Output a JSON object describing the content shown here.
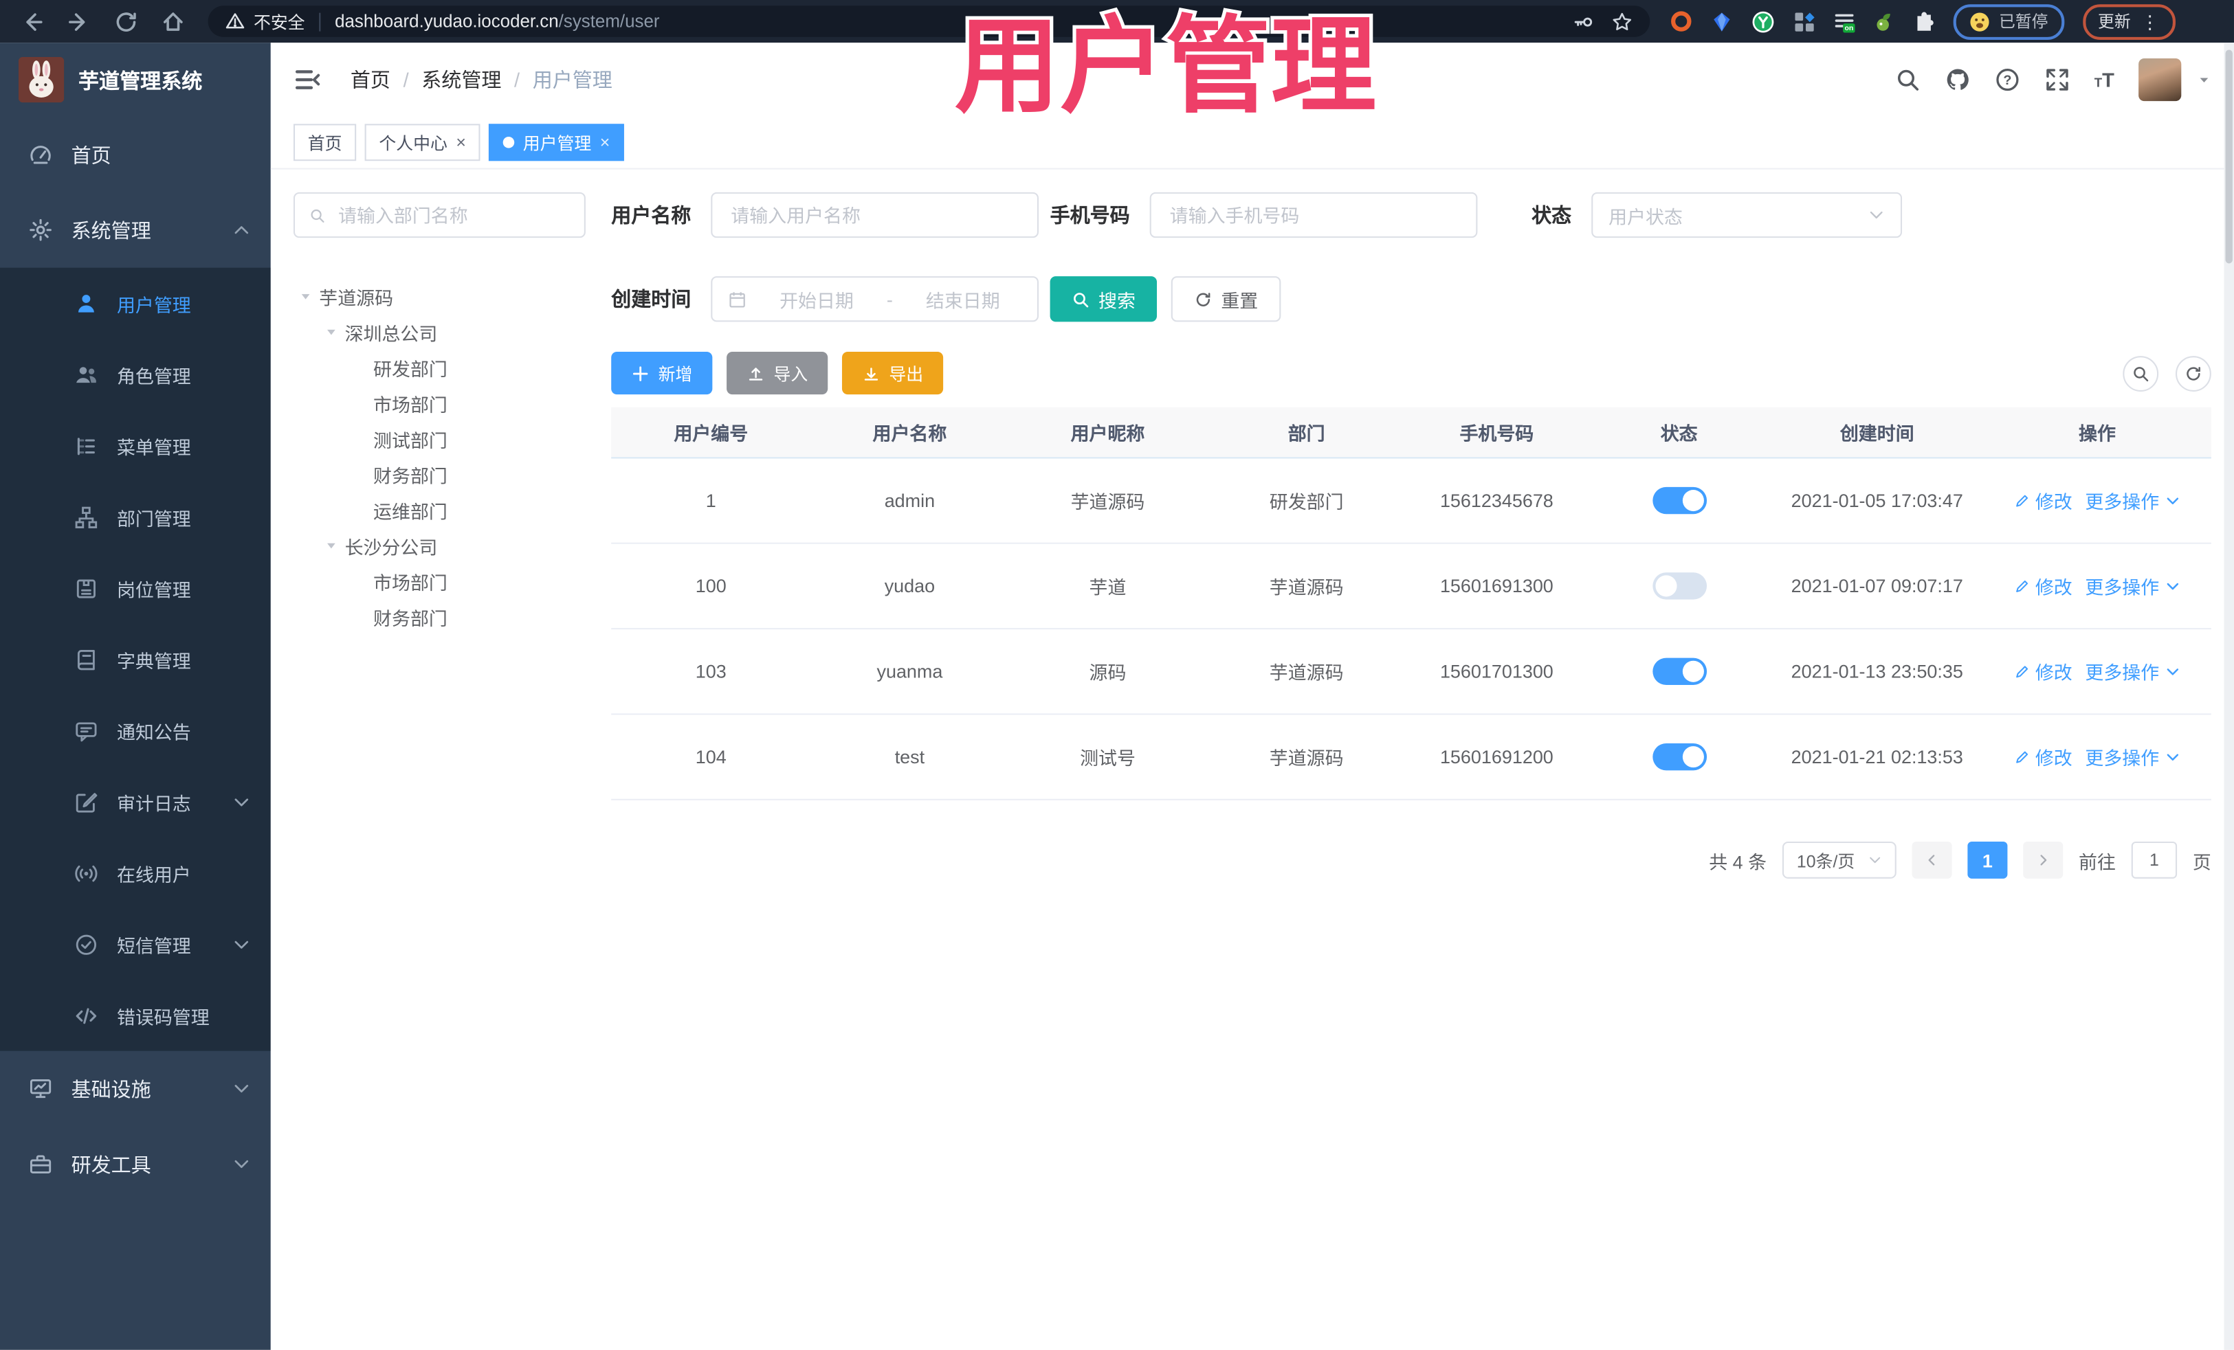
{
  "colors": {
    "primary": "#409eff",
    "success_teal": "#17b3a3",
    "warning_amber": "#efa41b",
    "info_gray": "#909399",
    "sidebar_bg": "#304156",
    "submenu_bg": "#1f2d3d",
    "overlay_pink": "#ee3f68"
  },
  "glyphs": {
    "close": "×",
    "kebab": "⋮",
    "question": "?",
    "font_small": "T",
    "font_big": "T",
    "breadcrumb_sep": "/"
  },
  "browser": {
    "security_label": "不安全",
    "url_host": "dashboard.yudao.iocoder.cn",
    "url_path": "/system/user",
    "tampermonkey_badge": "on",
    "paused_badge": "已暂停",
    "update_button": "更新"
  },
  "overlay": {
    "text": "用户管理"
  },
  "app": {
    "logo_title": "芋道管理系统"
  },
  "breadcrumb": {
    "items": [
      "首页",
      "系统管理",
      "用户管理"
    ]
  },
  "tabs": [
    {
      "label": "首页"
    },
    {
      "label": "个人中心"
    },
    {
      "label": "用户管理"
    }
  ],
  "sidebar": {
    "items": [
      {
        "label": "首页"
      },
      {
        "label": "系统管理"
      },
      {
        "label": "用户管理"
      },
      {
        "label": "角色管理"
      },
      {
        "label": "菜单管理"
      },
      {
        "label": "部门管理"
      },
      {
        "label": "岗位管理"
      },
      {
        "label": "字典管理"
      },
      {
        "label": "通知公告"
      },
      {
        "label": "审计日志"
      },
      {
        "label": "在线用户"
      },
      {
        "label": "短信管理"
      },
      {
        "label": "错误码管理"
      },
      {
        "label": "基础设施"
      },
      {
        "label": "研发工具"
      }
    ]
  },
  "tree": {
    "search_placeholder": "请输入部门名称",
    "nodes": [
      "芋道源码",
      "深圳总公司",
      "研发部门",
      "市场部门",
      "测试部门",
      "财务部门",
      "运维部门",
      "长沙分公司",
      "市场部门",
      "财务部门"
    ]
  },
  "filters": {
    "username_label": "用户名称",
    "username_placeholder": "请输入用户名称",
    "mobile_label": "手机号码",
    "mobile_placeholder": "请输入手机号码",
    "status_label": "状态",
    "status_placeholder": "用户状态",
    "date_label": "创建时间",
    "date_start": "开始日期",
    "date_sep": "-",
    "date_end": "结束日期",
    "search_button": "搜索",
    "reset_button": "重置"
  },
  "toolbar": {
    "add": "新增",
    "import": "导入",
    "export": "导出"
  },
  "table": {
    "columns": [
      "用户编号",
      "用户名称",
      "用户昵称",
      "部门",
      "手机号码",
      "状态",
      "创建时间",
      "操作"
    ],
    "edit_label": "修改",
    "more_label": "更多操作",
    "rows": [
      {
        "id": "1",
        "username": "admin",
        "nickname": "芋道源码",
        "dept": "研发部门",
        "mobile": "15612345678",
        "status": "on",
        "created": "2021-01-05 17:03:47"
      },
      {
        "id": "100",
        "username": "yudao",
        "nickname": "芋道",
        "dept": "芋道源码",
        "mobile": "15601691300",
        "status": "off",
        "created": "2021-01-07 09:07:17"
      },
      {
        "id": "103",
        "username": "yuanma",
        "nickname": "源码",
        "dept": "芋道源码",
        "mobile": "15601701300",
        "status": "on",
        "created": "2021-01-13 23:50:35"
      },
      {
        "id": "104",
        "username": "test",
        "nickname": "测试号",
        "dept": "芋道源码",
        "mobile": "15601691200",
        "status": "on",
        "created": "2021-01-21 02:13:53"
      }
    ]
  },
  "pagination": {
    "total": "共 4 条",
    "page_size": "10条/页",
    "current": "1",
    "goto_label": "前往",
    "goto_value": "1",
    "page_suffix": "页"
  }
}
